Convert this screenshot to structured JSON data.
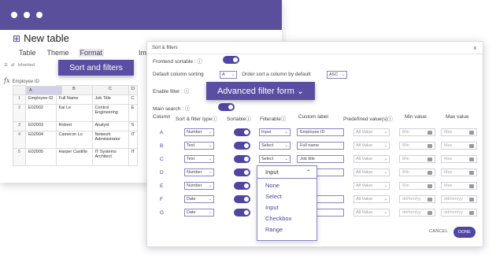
{
  "page": {
    "title": "New table"
  },
  "menu": [
    "Table",
    "Theme",
    "Format",
    "Import & S"
  ],
  "sort_popup": "Sort and filters",
  "toolbar": [
    "Inherited"
  ],
  "formula": {
    "fx": "fx",
    "cell": "Employee ID"
  },
  "sheet": {
    "headers": [
      "A",
      "B",
      "C",
      "D"
    ],
    "rows": [
      {
        "n": "1",
        "a": "Employee ID",
        "b": "Full Name",
        "c": "Job Title",
        "d": "C"
      },
      {
        "n": "2",
        "a": "E02002",
        "b": "Kai Le",
        "c": "Control Engineering",
        "d": "E"
      },
      {
        "n": "3",
        "a": "E02003",
        "b": "Robert",
        "c": "Analyst",
        "d": "S"
      },
      {
        "n": "4",
        "a": "E02004",
        "b": "Cameron Lo",
        "c": "Network Administrator",
        "d": "IT"
      },
      {
        "n": "5",
        "a": "E02005",
        "b": "Harper Castillo",
        "c": "IT Systems Architect",
        "d": "IT"
      }
    ]
  },
  "dialog": {
    "title": "Sort & filters",
    "close": "x",
    "frontend_sortable": "Frontend sortable :",
    "default_sorting": "Default column sorting",
    "default_sort_col": "A",
    "order_by": "Order sort a column by default",
    "order_val": "ASC",
    "enable_filter": "Enable filter :",
    "main_search": "Main search :",
    "advanced_popup": "Advanced filter form",
    "headers": {
      "column": "Column",
      "sort_type": "Sort & filter type",
      "sortable": "Sortable",
      "filterable": "Filterable",
      "custom_label": "Custom label",
      "predefined": "Predefined value(s)",
      "min": "Min value",
      "max": "Max value"
    },
    "rows": [
      {
        "col": "A",
        "type": "Number",
        "filter": "Input",
        "label": "Employee ID",
        "pre": "All Value",
        "min": "Min",
        "max": "Max"
      },
      {
        "col": "B",
        "type": "Text",
        "filter": "Select",
        "label": "Full name",
        "pre": "All Value",
        "min": "Min",
        "max": "Max"
      },
      {
        "col": "C",
        "type": "Text",
        "filter": "Select",
        "label": "Job title",
        "pre": "All Value",
        "min": "Min",
        "max": "Max"
      },
      {
        "col": "D",
        "type": "Number",
        "filter": "Input",
        "label": "ent",
        "pre": "All Value",
        "min": "Min",
        "max": "Max"
      },
      {
        "col": "E",
        "type": "Number",
        "filter": "",
        "label": "",
        "pre": "All Value",
        "min": "Min",
        "max": "Max"
      },
      {
        "col": "F",
        "type": "Date",
        "filter": "",
        "label": "e",
        "pre": "All Value",
        "min": "dd/mm/yy",
        "max": "dd/mm/yy"
      },
      {
        "col": "G",
        "type": "Date",
        "filter": "",
        "label": "e",
        "pre": "All Value",
        "min": "dd/mm/yy",
        "max": "dd/mm/yy"
      }
    ],
    "dropdown": {
      "current": "Input",
      "options": [
        "None",
        "Select",
        "Input",
        "Checkbox",
        "Range"
      ]
    },
    "cancel": "CANCEL",
    "done": "DONE",
    "info_icon": "info-icon"
  },
  "colors": {
    "accent": "#4e45a4",
    "title_bar": "#594f9a",
    "popup": "#5a4ea3"
  }
}
